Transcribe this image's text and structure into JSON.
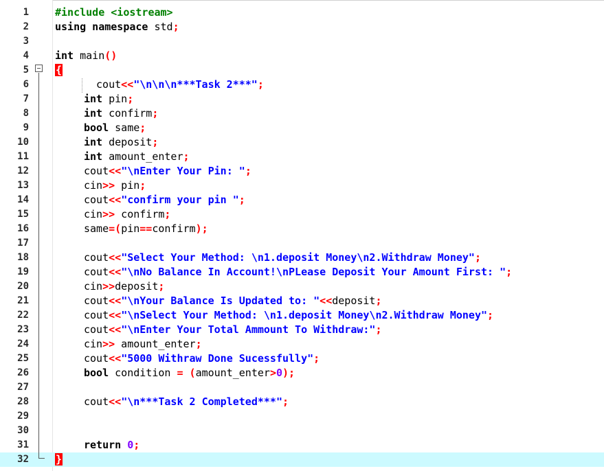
{
  "editor": {
    "current_line": 32,
    "lines": [
      {
        "n": "1",
        "tokens": [
          {
            "t": "#include <iostream>",
            "c": "pp"
          }
        ]
      },
      {
        "n": "2",
        "tokens": [
          {
            "t": "using namespace ",
            "c": "kw"
          },
          {
            "t": "std",
            "c": "id"
          },
          {
            "t": ";",
            "c": "op"
          }
        ]
      },
      {
        "n": "3",
        "tokens": []
      },
      {
        "n": "4",
        "tokens": [
          {
            "t": "int ",
            "c": "kw"
          },
          {
            "t": "main",
            "c": "id"
          },
          {
            "t": "()",
            "c": "op"
          }
        ]
      },
      {
        "n": "5",
        "tokens": [
          {
            "t": "{",
            "c": "brace"
          }
        ]
      },
      {
        "n": "6",
        "tokens": [
          {
            "t": " cout",
            "c": "id"
          },
          {
            "t": "<<",
            "c": "op"
          },
          {
            "t": "\"\\n\\n\\n***Task 2***\"",
            "c": "str"
          },
          {
            "t": ";",
            "c": "op"
          }
        ],
        "indent": "guide"
      },
      {
        "n": "7",
        "tokens": [
          {
            "t": "int ",
            "c": "kw"
          },
          {
            "t": "pin",
            "c": "id"
          },
          {
            "t": ";",
            "c": "op"
          }
        ],
        "indent": "yes"
      },
      {
        "n": "8",
        "tokens": [
          {
            "t": "int ",
            "c": "kw"
          },
          {
            "t": "confirm",
            "c": "id"
          },
          {
            "t": ";",
            "c": "op"
          }
        ],
        "indent": "yes"
      },
      {
        "n": "9",
        "tokens": [
          {
            "t": "bool ",
            "c": "kw"
          },
          {
            "t": "same",
            "c": "id"
          },
          {
            "t": ";",
            "c": "op"
          }
        ],
        "indent": "yes"
      },
      {
        "n": "10",
        "tokens": [
          {
            "t": "int ",
            "c": "kw"
          },
          {
            "t": "deposit",
            "c": "id"
          },
          {
            "t": ";",
            "c": "op"
          }
        ],
        "indent": "yes"
      },
      {
        "n": "11",
        "tokens": [
          {
            "t": "int ",
            "c": "kw"
          },
          {
            "t": "amount_enter",
            "c": "id"
          },
          {
            "t": ";",
            "c": "op"
          }
        ],
        "indent": "yes"
      },
      {
        "n": "12",
        "tokens": [
          {
            "t": "cout",
            "c": "id"
          },
          {
            "t": "<<",
            "c": "op"
          },
          {
            "t": "\"\\nEnter Your Pin: \"",
            "c": "str"
          },
          {
            "t": ";",
            "c": "op"
          }
        ],
        "indent": "yes"
      },
      {
        "n": "13",
        "tokens": [
          {
            "t": "cin",
            "c": "id"
          },
          {
            "t": ">>",
            "c": "op"
          },
          {
            "t": " pin",
            "c": "id"
          },
          {
            "t": ";",
            "c": "op"
          }
        ],
        "indent": "yes"
      },
      {
        "n": "14",
        "tokens": [
          {
            "t": "cout",
            "c": "id"
          },
          {
            "t": "<<",
            "c": "op"
          },
          {
            "t": "\"confirm your pin \"",
            "c": "str"
          },
          {
            "t": ";",
            "c": "op"
          }
        ],
        "indent": "yes"
      },
      {
        "n": "15",
        "tokens": [
          {
            "t": "cin",
            "c": "id"
          },
          {
            "t": ">>",
            "c": "op"
          },
          {
            "t": " confirm",
            "c": "id"
          },
          {
            "t": ";",
            "c": "op"
          }
        ],
        "indent": "yes"
      },
      {
        "n": "16",
        "tokens": [
          {
            "t": "same",
            "c": "id"
          },
          {
            "t": "=(",
            "c": "op"
          },
          {
            "t": "pin",
            "c": "id"
          },
          {
            "t": "==",
            "c": "op"
          },
          {
            "t": "confirm",
            "c": "id"
          },
          {
            "t": ");",
            "c": "op"
          }
        ],
        "indent": "yes"
      },
      {
        "n": "17",
        "tokens": []
      },
      {
        "n": "18",
        "tokens": [
          {
            "t": "cout",
            "c": "id"
          },
          {
            "t": "<<",
            "c": "op"
          },
          {
            "t": "\"Select Your Method: \\n1.deposit Money\\n2.Withdraw Money\"",
            "c": "str"
          },
          {
            "t": ";",
            "c": "op"
          }
        ],
        "indent": "yes"
      },
      {
        "n": "19",
        "tokens": [
          {
            "t": "cout",
            "c": "id"
          },
          {
            "t": "<<",
            "c": "op"
          },
          {
            "t": "\"\\nNo Balance In Account!\\nPLease Deposit Your Amount First: \"",
            "c": "str"
          },
          {
            "t": ";",
            "c": "op"
          }
        ],
        "indent": "yes"
      },
      {
        "n": "20",
        "tokens": [
          {
            "t": "cin",
            "c": "id"
          },
          {
            "t": ">>",
            "c": "op"
          },
          {
            "t": "deposit",
            "c": "id"
          },
          {
            "t": ";",
            "c": "op"
          }
        ],
        "indent": "yes"
      },
      {
        "n": "21",
        "tokens": [
          {
            "t": "cout",
            "c": "id"
          },
          {
            "t": "<<",
            "c": "op"
          },
          {
            "t": "\"\\nYour Balance Is Updated to: \"",
            "c": "str"
          },
          {
            "t": "<<",
            "c": "op"
          },
          {
            "t": "deposit",
            "c": "id"
          },
          {
            "t": ";",
            "c": "op"
          }
        ],
        "indent": "yes"
      },
      {
        "n": "22",
        "tokens": [
          {
            "t": "cout",
            "c": "id"
          },
          {
            "t": "<<",
            "c": "op"
          },
          {
            "t": "\"\\nSelect Your Method: \\n1.deposit Money\\n2.Withdraw Money\"",
            "c": "str"
          },
          {
            "t": ";",
            "c": "op"
          }
        ],
        "indent": "yes"
      },
      {
        "n": "23",
        "tokens": [
          {
            "t": "cout",
            "c": "id"
          },
          {
            "t": "<<",
            "c": "op"
          },
          {
            "t": "\"\\nEnter Your Total Ammount To Withdraw:\"",
            "c": "str"
          },
          {
            "t": ";",
            "c": "op"
          }
        ],
        "indent": "yes"
      },
      {
        "n": "24",
        "tokens": [
          {
            "t": "cin",
            "c": "id"
          },
          {
            "t": ">>",
            "c": "op"
          },
          {
            "t": " amount_enter",
            "c": "id"
          },
          {
            "t": ";",
            "c": "op"
          }
        ],
        "indent": "yes"
      },
      {
        "n": "25",
        "tokens": [
          {
            "t": "cout",
            "c": "id"
          },
          {
            "t": "<<",
            "c": "op"
          },
          {
            "t": "\"5000 Withraw Done Sucessfully\"",
            "c": "str"
          },
          {
            "t": ";",
            "c": "op"
          }
        ],
        "indent": "yes"
      },
      {
        "n": "26",
        "tokens": [
          {
            "t": "bool ",
            "c": "kw"
          },
          {
            "t": "condition ",
            "c": "id"
          },
          {
            "t": "= (",
            "c": "op"
          },
          {
            "t": "amount_enter",
            "c": "id"
          },
          {
            "t": ">",
            "c": "op"
          },
          {
            "t": "0",
            "c": "num"
          },
          {
            "t": ");",
            "c": "op"
          }
        ],
        "indent": "yes"
      },
      {
        "n": "27",
        "tokens": []
      },
      {
        "n": "28",
        "tokens": [
          {
            "t": "cout",
            "c": "id"
          },
          {
            "t": "<<",
            "c": "op"
          },
          {
            "t": "\"\\n***Task 2 Completed***\"",
            "c": "str"
          },
          {
            "t": ";",
            "c": "op"
          }
        ],
        "indent": "yes"
      },
      {
        "n": "29",
        "tokens": []
      },
      {
        "n": "30",
        "tokens": []
      },
      {
        "n": "31",
        "tokens": [
          {
            "t": "return ",
            "c": "kw"
          },
          {
            "t": "0",
            "c": "num"
          },
          {
            "t": ";",
            "c": "op"
          }
        ],
        "indent": "yes"
      },
      {
        "n": "32",
        "tokens": [
          {
            "t": "}",
            "c": "brace"
          }
        ]
      }
    ]
  }
}
